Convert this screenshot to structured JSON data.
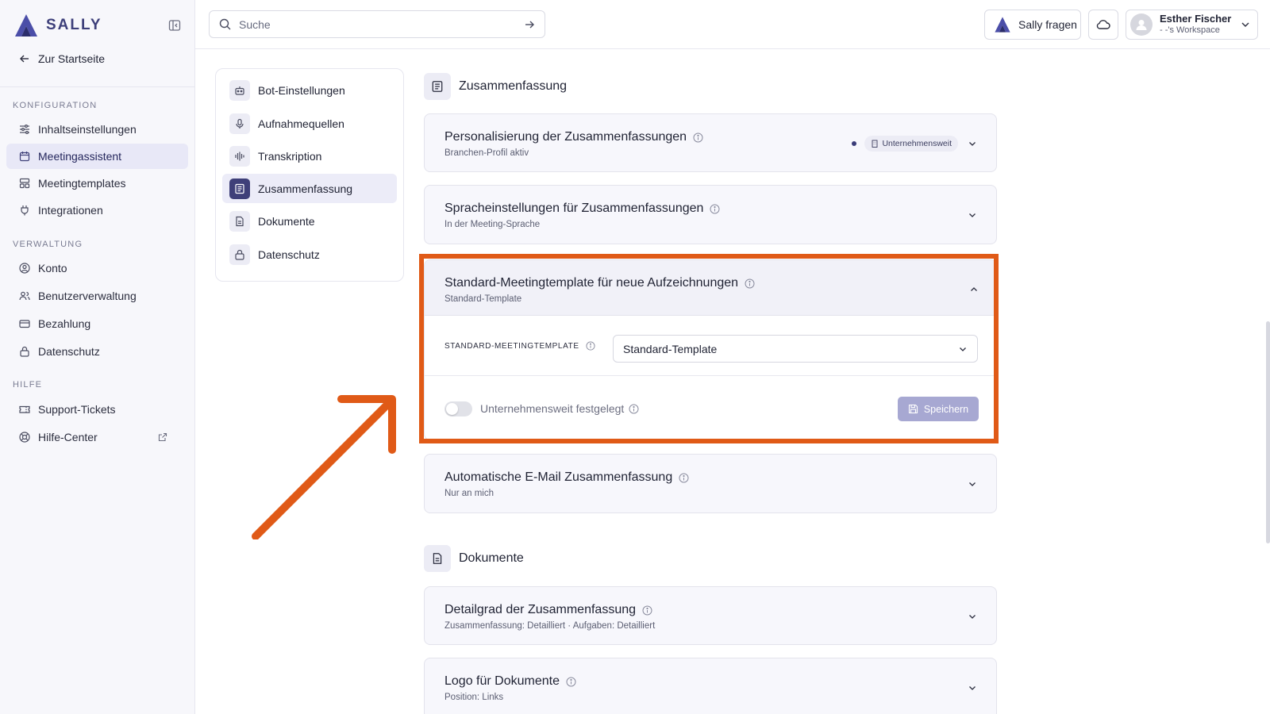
{
  "app": {
    "brand": "SALLY",
    "back_label": "Zur Startseite"
  },
  "sidebar": {
    "sections": [
      {
        "label": "KONFIGURATION",
        "items": [
          {
            "label": "Inhaltseinstellungen",
            "icon": "sliders-icon"
          },
          {
            "label": "Meetingassistent",
            "icon": "calendar-icon",
            "active": true
          },
          {
            "label": "Meetingtemplates",
            "icon": "template-icon"
          },
          {
            "label": "Integrationen",
            "icon": "plug-icon"
          }
        ]
      },
      {
        "label": "VERWALTUNG",
        "items": [
          {
            "label": "Konto",
            "icon": "user-circle-icon"
          },
          {
            "label": "Benutzerverwaltung",
            "icon": "users-icon"
          },
          {
            "label": "Bezahlung",
            "icon": "credit-card-icon"
          },
          {
            "label": "Datenschutz",
            "icon": "lock-icon"
          }
        ]
      },
      {
        "label": "HILFE",
        "items": [
          {
            "label": "Support-Tickets",
            "icon": "ticket-icon"
          },
          {
            "label": "Hilfe-Center",
            "icon": "lifebuoy-icon"
          }
        ]
      }
    ]
  },
  "topbar": {
    "search_placeholder": "Suche",
    "ask_label": "Sally fragen",
    "user_name": "Esther Fischer",
    "user_workspace": "- -'s Workspace"
  },
  "subnav": {
    "items": [
      {
        "label": "Bot-Einstellungen",
        "icon": "bot-icon"
      },
      {
        "label": "Aufnahmequellen",
        "icon": "microphone-icon"
      },
      {
        "label": "Transkription",
        "icon": "waveform-icon"
      },
      {
        "label": "Zusammenfassung",
        "icon": "summary-icon",
        "active": true
      },
      {
        "label": "Dokumente",
        "icon": "document-icon"
      },
      {
        "label": "Datenschutz",
        "icon": "lock-icon"
      }
    ]
  },
  "main": {
    "summary_section": {
      "title": "Zusammenfassung",
      "cards": [
        {
          "title": "Personalisierung der Zusammenfassungen",
          "subtitle": "Branchen-Profil aktiv",
          "badge": "Unternehmensweit"
        },
        {
          "title": "Spracheinstellungen für Zusammenfassungen",
          "subtitle": "In der Meeting-Sprache"
        }
      ],
      "open_card": {
        "title": "Standard-Meetingtemplate für neue Aufzeichnungen",
        "subtitle": "Standard-Template",
        "field_label": "STANDARD-MEETINGTEMPLATE",
        "select_value": "Standard-Template",
        "toggle_label": "Unternehmensweit festgelegt",
        "toggle_on": false,
        "save_label": "Speichern"
      },
      "after_cards": [
        {
          "title": "Automatische E-Mail Zusammenfassung",
          "subtitle": "Nur an mich"
        }
      ]
    },
    "documents_section": {
      "title": "Dokumente",
      "cards": [
        {
          "title": "Detailgrad der Zusammenfassung",
          "subtitle": "Zusammenfassung: Detailliert · Aufgaben: Detailliert"
        },
        {
          "title": "Logo für Dokumente",
          "subtitle": "Position: Links"
        }
      ]
    }
  },
  "colors": {
    "accent": "#3f4079",
    "highlight": "#e05a17",
    "sidebar_bg": "#f7f7fb",
    "save_button": "#a7a8d2"
  }
}
